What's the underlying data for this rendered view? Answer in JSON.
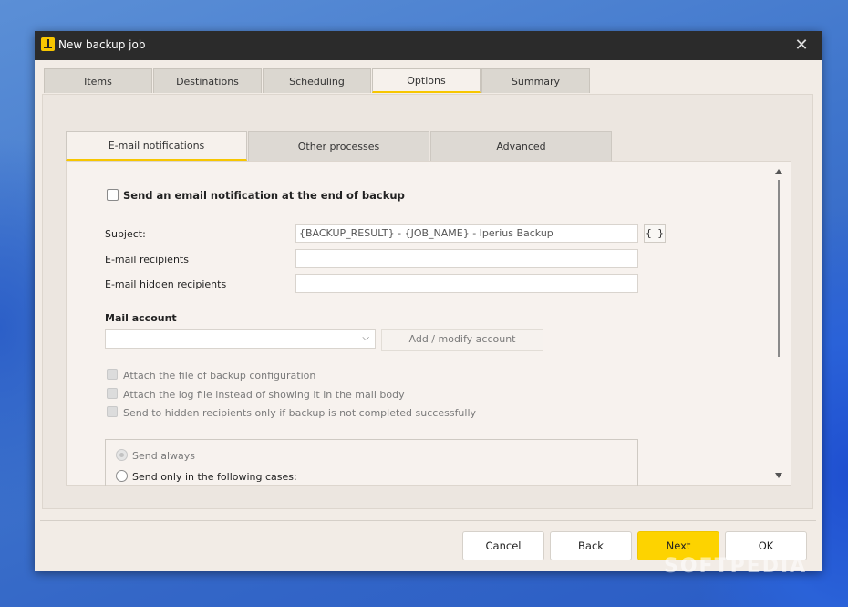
{
  "window": {
    "title": "New backup job",
    "close_symbol": "✕"
  },
  "tabs": [
    "Items",
    "Destinations",
    "Scheduling",
    "Options",
    "Summary"
  ],
  "subtabs": [
    "E-mail notifications",
    "Other processes",
    "Advanced"
  ],
  "email": {
    "send_label": "Send an email notification at the end of backup",
    "subject_label": "Subject:",
    "subject_value": "{BACKUP_RESULT} - {JOB_NAME} - Iperius Backup",
    "variables_button": "{ }",
    "recipients_label": "E-mail recipients",
    "recipients_value": "",
    "hidden_label": "E-mail hidden recipients",
    "hidden_value": "",
    "mail_account_label": "Mail account",
    "mail_account_value": "",
    "add_account_button": "Add / modify account",
    "attach_config_label": "Attach the file of backup configuration",
    "attach_log_label": "Attach the log file instead of showing it in the mail body",
    "hidden_only_label": "Send to hidden recipients only if backup is not completed successfully",
    "send_always_label": "Send always",
    "send_cases_label": "Send only in the following cases:"
  },
  "footer": {
    "cancel": "Cancel",
    "back": "Back",
    "next": "Next",
    "ok": "OK"
  },
  "watermark": "SOFTPEDIA",
  "colors": {
    "accent": "#fdd300",
    "titlebar": "#2b2b2b",
    "panel": "#f2ece6"
  }
}
